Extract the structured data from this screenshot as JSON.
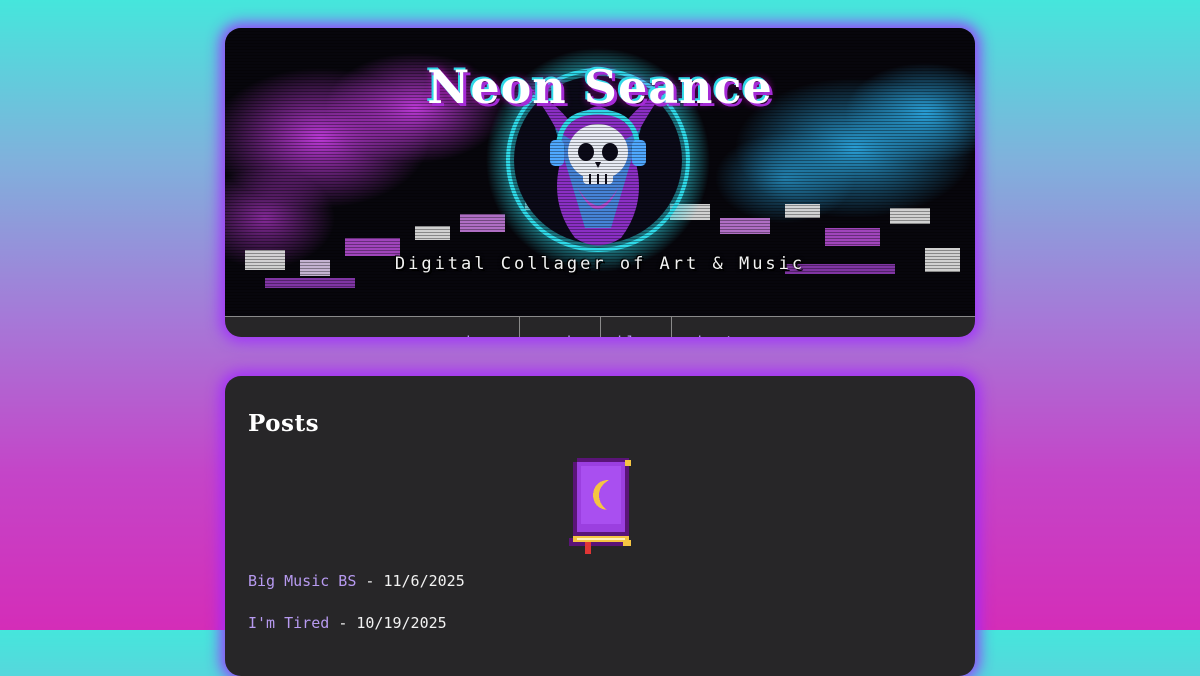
{
  "site": {
    "title": "Neon Seance",
    "subtitle": "Digital Collager of Art & Music"
  },
  "nav": {
    "items": [
      {
        "label": "home"
      },
      {
        "label": "music"
      },
      {
        "label": "blog"
      },
      {
        "label": "about"
      }
    ]
  },
  "posts": {
    "heading": "Posts",
    "icon": "spellbook-moon-icon",
    "separator": "-",
    "items": [
      {
        "title": "Big Music BS",
        "date": "11/6/2025"
      },
      {
        "title": "I'm Tired",
        "date": "10/19/2025"
      }
    ]
  },
  "colors": {
    "link": "#b79af0",
    "card": "#272628",
    "glow": "#a028ff",
    "magenta": "#c43be0",
    "cyan": "#2fd9e8"
  }
}
